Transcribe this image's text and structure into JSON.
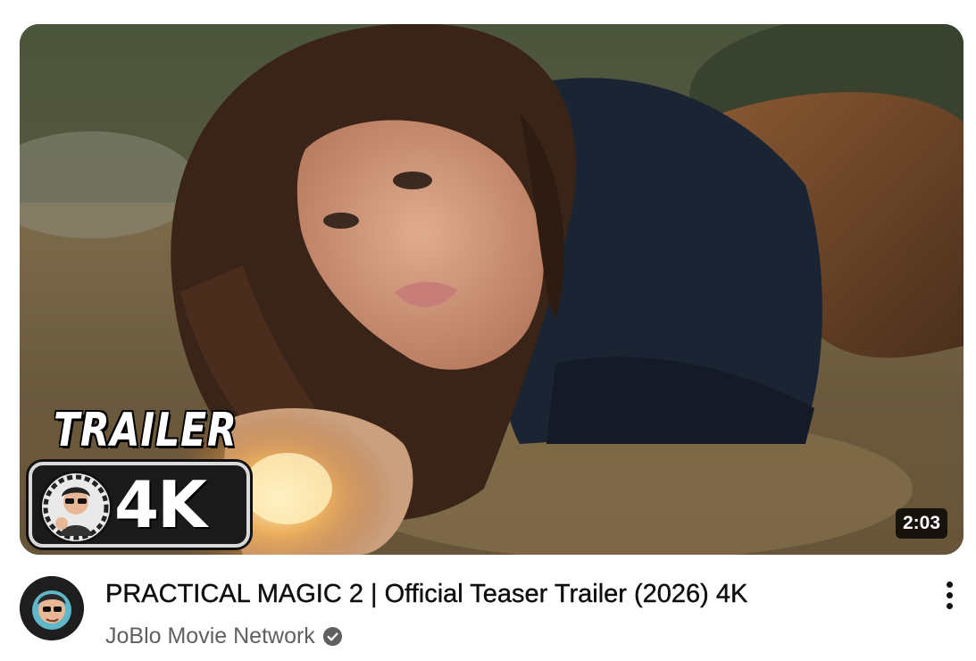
{
  "video": {
    "title": "PRACTICAL MAGIC 2 | Official Teaser Trailer (2026) 4K",
    "channel": "JoBlo Movie Network",
    "duration": "2:03",
    "verified_icon": "verified-check-icon"
  },
  "thumbnail": {
    "overlay_label": "TRAILER",
    "badge_label": "4K"
  },
  "menu_icon": "more-vertical-icon",
  "colors": {
    "title_text": "#0f0f0f",
    "channel_text": "#606060",
    "duration_bg": "#000000",
    "duration_text": "#ffffff"
  }
}
